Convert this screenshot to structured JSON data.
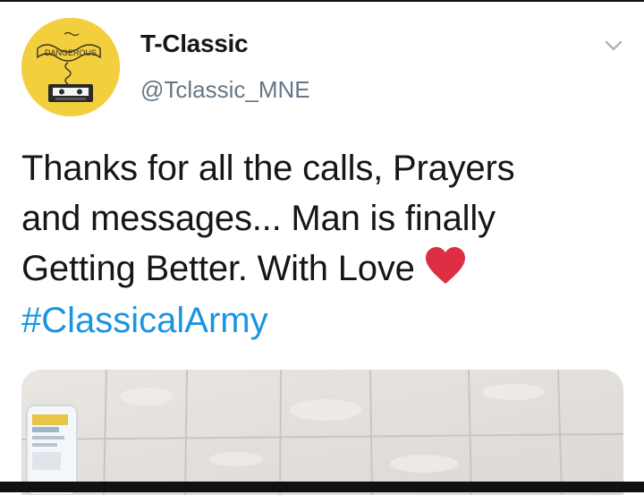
{
  "user": {
    "display_name": "T-Classic",
    "handle": "@Tclassic_MNE",
    "avatar_text": "DANGEROUS"
  },
  "tweet": {
    "lines": [
      "Thanks for all the calls, Prayers",
      "and messages... Man is finally",
      "Getting Better. With Love"
    ],
    "emoji": "heart-icon",
    "hashtag": "#ClassicalArmy"
  },
  "colors": {
    "text": "#14171a",
    "secondary": "#657786",
    "link": "#1b95e0",
    "avatar_bg": "#f3cf3e",
    "heart": "#dd2e44"
  },
  "icons": {
    "menu": "chevron-down-icon",
    "avatar": "cassette-tape-icon"
  }
}
